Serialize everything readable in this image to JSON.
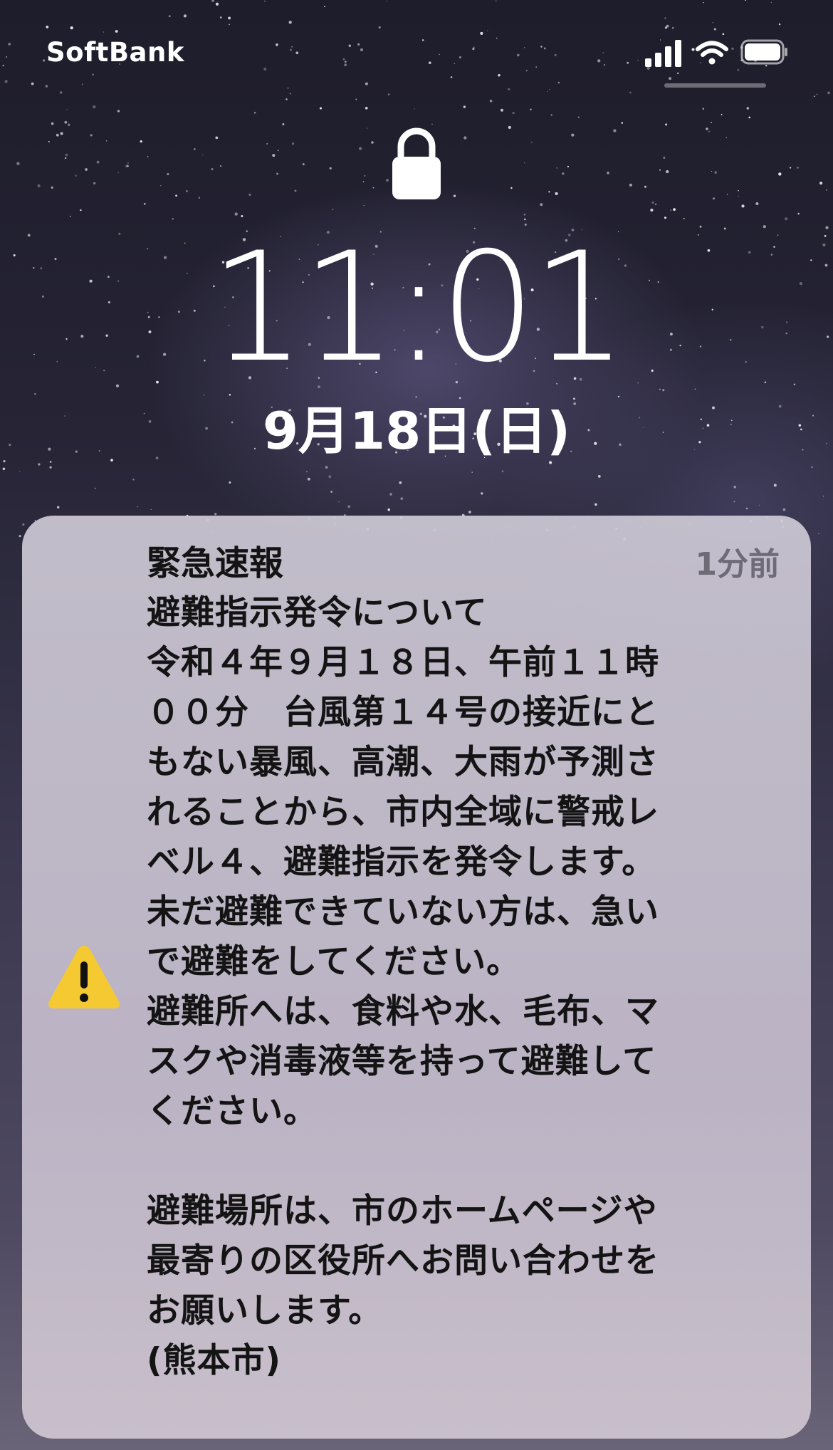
{
  "status_bar": {
    "carrier": "SoftBank",
    "signal_icon": "cellular-signal-icon",
    "wifi_icon": "wifi-icon",
    "battery_icon": "battery-icon",
    "battery_level": 1.0
  },
  "lock_screen": {
    "lock_icon": "lock-icon",
    "time": "11:01",
    "date": "9月18日(日)"
  },
  "notification": {
    "icon": "warning-icon",
    "accent_color": "#f5c932",
    "title": "緊急速報",
    "time_ago": "1分前",
    "body": "避難指示発令について\n令和４年９月１８日、午前１１時\n００分　台風第１４号の接近にと\nもない暴風、高潮、大雨が予測さ\nれることから、市内全域に警戒レ\nベル４、避難指示を発令します。\n未だ避難できていない方は、急い\nで避難をしてください。\n避難所へは、食料や水、毛布、マ\nスクや消毒液等を持って避難して\nください。\n\n避難場所は、市のホームページや\n最寄りの区役所へお問い合わせを\nお願いします。\n(熊本市)"
  }
}
